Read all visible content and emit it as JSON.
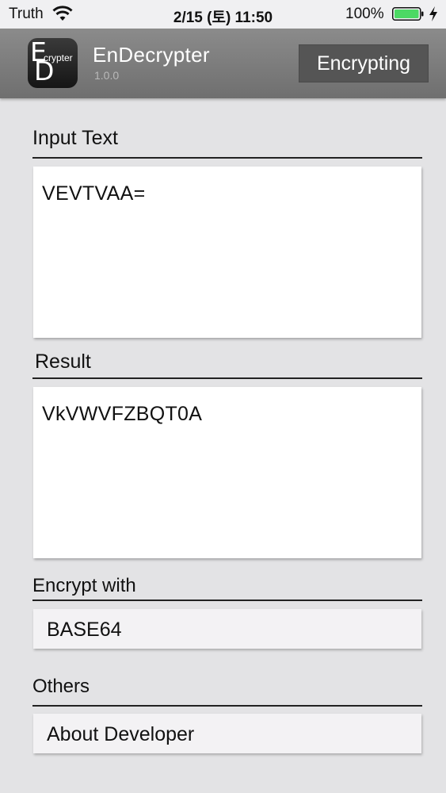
{
  "status_bar": {
    "carrier": "Truth",
    "time": "2/15 (토) 11:50",
    "battery_percent": "100%",
    "battery_color": "#4cd964"
  },
  "app_header": {
    "title": "EnDecrypter",
    "version": "1.0.0",
    "mode_button_label": "Encrypting",
    "logo_letters": [
      "E",
      "crypter",
      "D"
    ]
  },
  "input_section": {
    "label": "Input Text",
    "value": "VEVTVAA="
  },
  "result_section": {
    "label": "Result",
    "value": "VkVWVFZBQT0A"
  },
  "encrypt_section": {
    "label": "Encrypt with",
    "selected_method": "BASE64"
  },
  "others_section": {
    "label": "Others",
    "about_label": "About Developer"
  }
}
